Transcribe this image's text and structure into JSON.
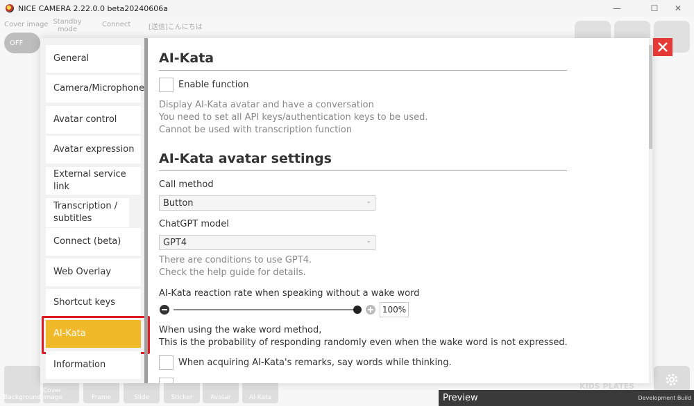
{
  "window": {
    "title": "NICE CAMERA 2.22.0.0 beta20240606a",
    "controls": {
      "minimize": "—",
      "maximize": "☐",
      "close": "✕"
    }
  },
  "background": {
    "top_labels": [
      "Cover image",
      "Standby mode",
      "Connect",
      "[送信]こんにちは"
    ],
    "toggle_label": "OFF",
    "bottom_items": [
      "Background",
      "Cover image",
      "Frame",
      "Slide",
      "Sticker",
      "Avatar",
      "AI-Kata"
    ],
    "kids_plates": "KIDS PLATES",
    "preview_label": "Preview",
    "build_label": "Development Build"
  },
  "sidebar": {
    "items": [
      {
        "label": "General"
      },
      {
        "label": "Camera/Microphone"
      },
      {
        "label": "Avatar control"
      },
      {
        "label": "Avatar expression"
      },
      {
        "label": "External service link"
      },
      {
        "label": "Transcription / subtitles"
      },
      {
        "label": "Connect (beta)"
      },
      {
        "label": "Web Overlay"
      },
      {
        "label": "Shortcut keys"
      },
      {
        "label": "AI-Kata"
      },
      {
        "label": "Information"
      }
    ],
    "active": "AI-Kata"
  },
  "content": {
    "section1": {
      "title": "AI-Kata",
      "enable_label": "Enable function",
      "enable_checked": false,
      "desc1": "Display AI-Kata avatar and have a conversation",
      "desc2": "You need to set all API keys/authentication keys to be used.",
      "desc3": "Cannot be used with transcription function"
    },
    "section2": {
      "title": "AI-Kata avatar settings",
      "call_method_label": "Call method",
      "call_method_value": "Button",
      "model_label": "ChatGPT model",
      "model_value": "GPT4",
      "model_note1": "There are conditions to use GPT4.",
      "model_note2": "Check the help guide for details.",
      "rate_label": "AI-Kata reaction rate when speaking without a wake word",
      "rate_value": "100%",
      "rate_fraction": 1.0,
      "wake_line1": "When using the wake word method,",
      "wake_line2": "This is the probability of responding randomly even when the wake word is not expressed.",
      "thinking_label": "When acquiring AI-Kata's remarks, say words while thinking.",
      "thinking_checked": false
    }
  },
  "colors": {
    "accent": "#f0b92a",
    "highlight_outline": "#e01b24",
    "close_button": "#e53935"
  }
}
